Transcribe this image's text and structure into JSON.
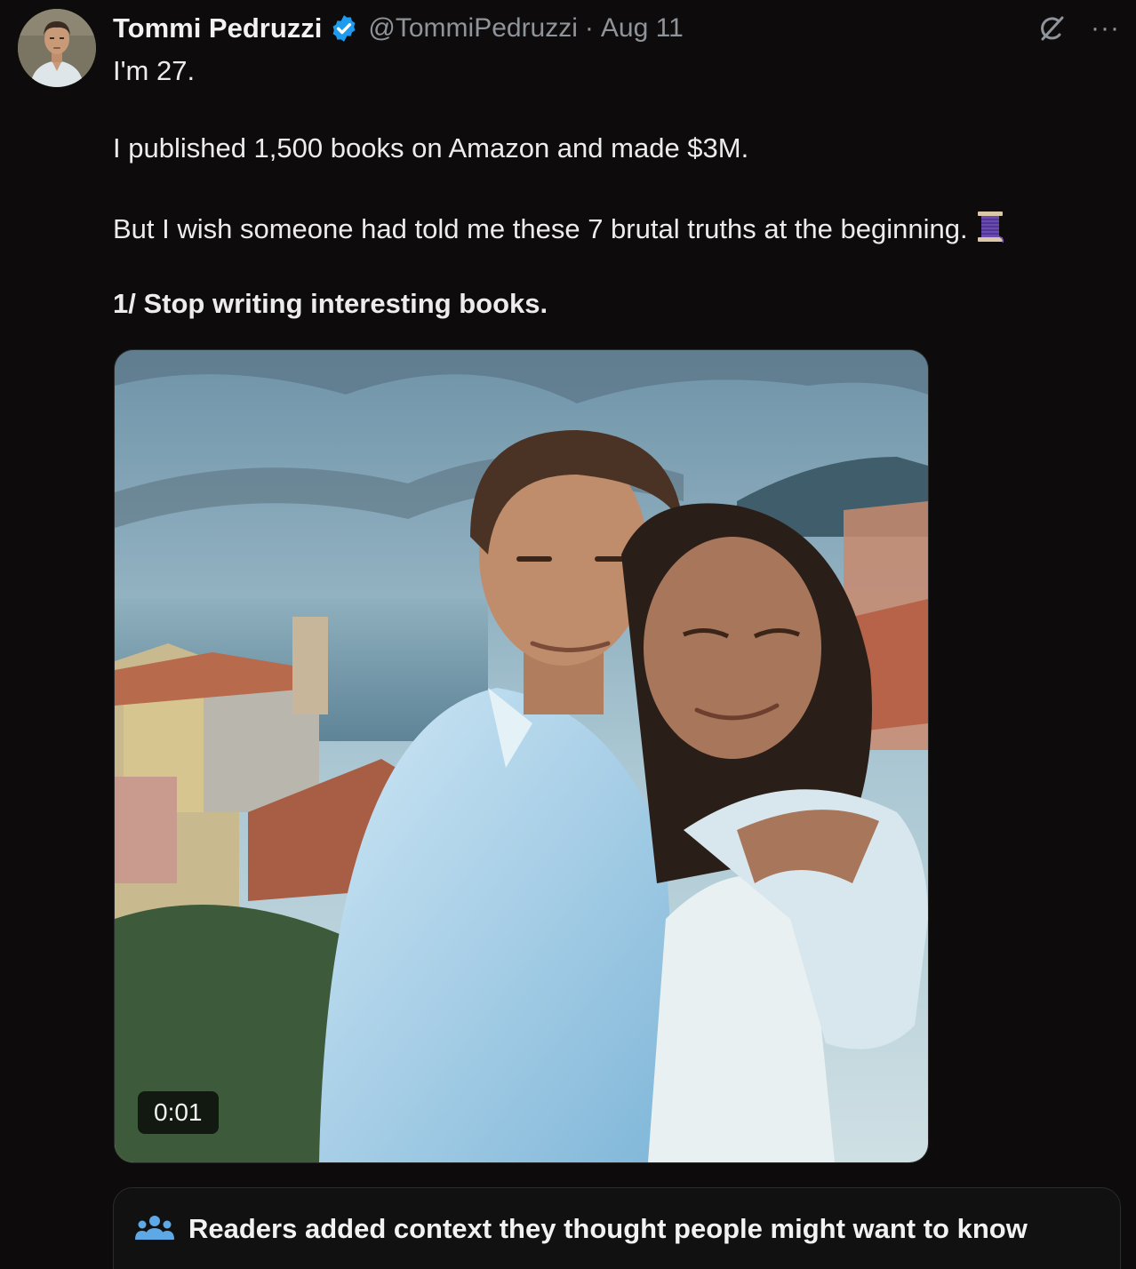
{
  "author": {
    "name": "Tommi Pedruzzi",
    "handle": "@TommiPedruzzi",
    "separator": "·",
    "date": "Aug 11"
  },
  "icons": {
    "verified": "verified-badge-icon",
    "grok": "grok-icon",
    "more": "more-options-icon",
    "thread": "spool-thread-icon",
    "people": "people-icon"
  },
  "more_glyph": "···",
  "tweet": {
    "line1": "I'm 27.",
    "line2": "I published 1,500 books on Amazon and made $3M.",
    "line3": "But I wish someone had told me these 7 brutal truths at the beginning.",
    "line4": "1/ Stop writing interesting books."
  },
  "media": {
    "timestamp": "0:01"
  },
  "community_note": {
    "title": "Readers added context they thought people might want to know"
  },
  "colors": {
    "background": "#0d0b0b",
    "verified": "#1d9bf0",
    "muted": "#8f949a",
    "note_icon": "#5fa8e6"
  }
}
